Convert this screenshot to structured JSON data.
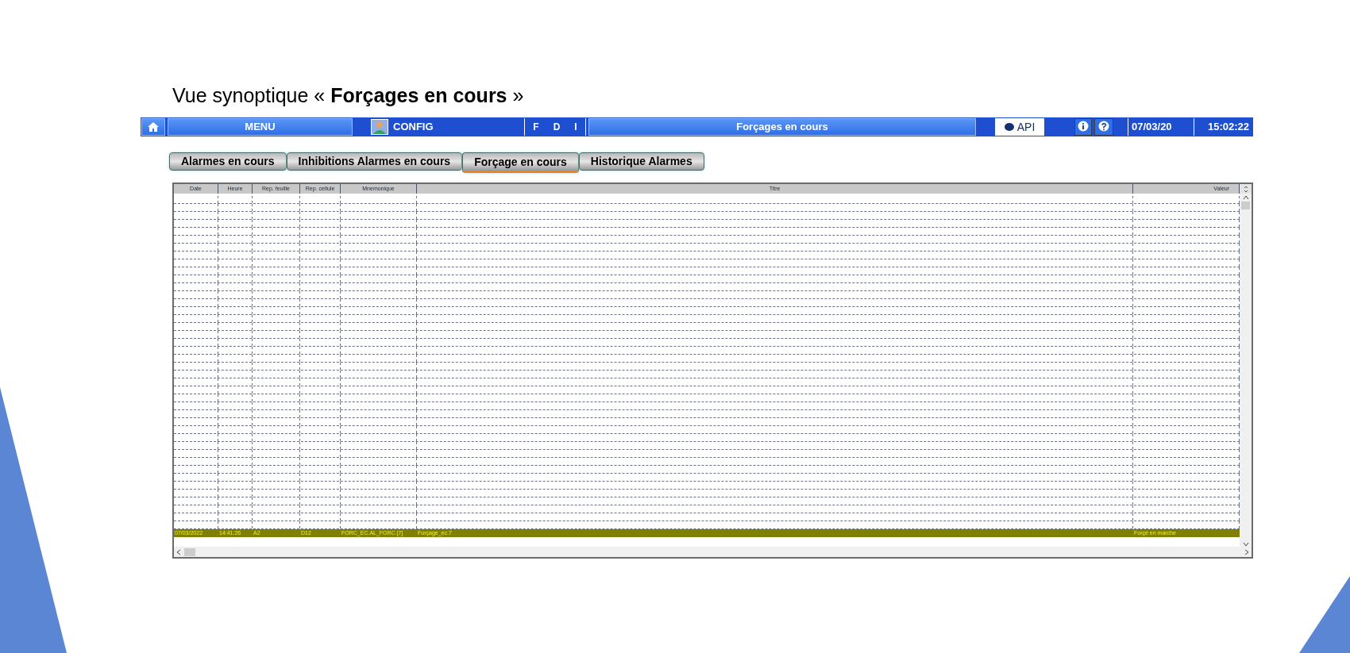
{
  "heading": "Vue synoptique « **Forçages en cours** »",
  "toolbar": {
    "menu": "MENU",
    "config": "CONFIG",
    "fdi": [
      "F",
      "D",
      "I"
    ],
    "title": "Forçages en cours",
    "api": "API",
    "date": "07/03/20",
    "time": "15:02:22"
  },
  "tabs": [
    {
      "label": "Alarmes en cours",
      "selected": false
    },
    {
      "label": "Inhibitions Alarmes en cours",
      "selected": false
    },
    {
      "label": "Forçage en cours",
      "selected": true
    },
    {
      "label": "Historique Alarmes",
      "selected": false
    }
  ],
  "table": {
    "columns": [
      "Date",
      "Heure",
      "Rep. feuille",
      "Rep. cellule",
      "Mnemonique",
      "Titre",
      "Valeur"
    ],
    "rows": [
      {
        "selected": true,
        "cells": [
          "07/03/2022",
          "14:41:26",
          "A2",
          "D12",
          "FORC_EC.AL_FORC.[7]",
          "Forçage_ec.7",
          "Forçé en marche"
        ]
      }
    ]
  }
}
